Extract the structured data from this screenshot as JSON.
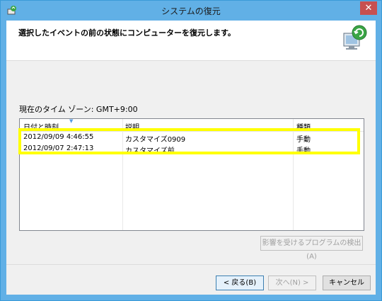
{
  "window": {
    "title": "システムの復元",
    "close_label": "✕"
  },
  "header": {
    "instruction": "選択したイベントの前の状態にコンピューターを復元します。"
  },
  "timezone": {
    "label": "現在のタイム ゾーン: GMT+9:00"
  },
  "table": {
    "columns": [
      "日付と時刻",
      "説明",
      "種類"
    ],
    "rows": [
      {
        "datetime": "2012/09/09 4:46:55",
        "description": "カスタマイズ0909",
        "type": "手動"
      },
      {
        "datetime": "2012/09/07 2:47:13",
        "description": "カスタマイズ前",
        "type": "手動"
      }
    ]
  },
  "buttons": {
    "scan": "影響を受けるプログラムの検出(A)",
    "back": "< 戻る(B)",
    "next": "次へ(N) >",
    "cancel": "キャンセル"
  },
  "colors": {
    "titlebar": "#61b0e6",
    "highlight": "#ffff00",
    "close": "#c75050"
  }
}
